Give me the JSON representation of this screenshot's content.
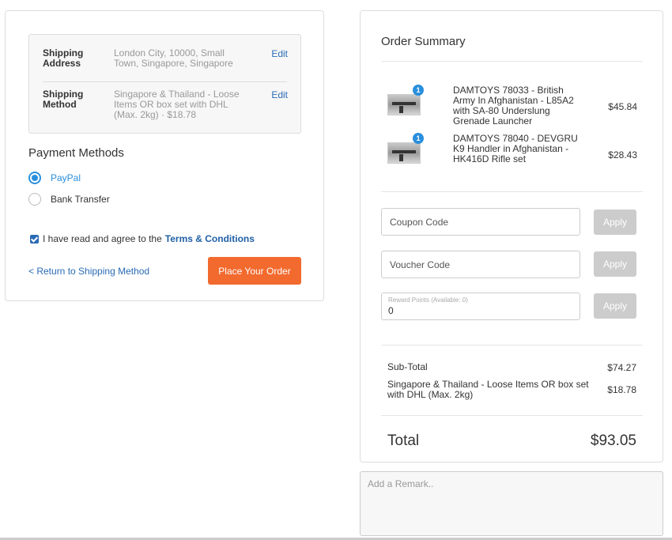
{
  "shipping": {
    "address_label": "Shipping Address",
    "address_value": "London City, 10000, Small Town, Singapore, Singapore",
    "method_label": "Shipping Method",
    "method_value": "Singapore & Thailand - Loose Items OR box set with DHL (Max. 2kg) · $18.78",
    "edit_label": "Edit"
  },
  "payment": {
    "title": "Payment Methods",
    "options": [
      {
        "label": "PayPal",
        "selected": true
      },
      {
        "label": "Bank Transfer",
        "selected": false
      }
    ]
  },
  "agreement": {
    "text": "I have read and agree to the",
    "link": "Terms & Conditions",
    "checked": true
  },
  "actions": {
    "return_label": "< Return to Shipping Method",
    "place_order_label": "Place Your Order"
  },
  "order_summary": {
    "title": "Order Summary",
    "items": [
      {
        "qty": "1",
        "name": "DAMTOYS 78033 - British Army In Afghanistan - L85A2 with SA-80 Underslung Grenade Launcher",
        "price": "$45.84",
        "thumb_icon": "rifle-icon"
      },
      {
        "qty": "1",
        "name": "DAMTOYS 78040 - DEVGRU K9 Handler in Afghanistan - HK416D Rifle set",
        "price": "$28.43",
        "thumb_icon": "rifle-icon"
      }
    ],
    "coupon_placeholder": "Coupon Code",
    "voucher_placeholder": "Voucher Code",
    "reward_label": "Reward Points (Available: 0)",
    "reward_value": "0",
    "apply_label": "Apply",
    "subtotal_label": "Sub-Total",
    "subtotal_value": "$74.27",
    "shipping_label": "Singapore & Thailand - Loose Items OR box set with DHL (Max. 2kg)",
    "shipping_value": "$18.78",
    "total_label": "Total",
    "total_value": "$93.05"
  },
  "remark_placeholder": "Add a Remark..",
  "colors": {
    "accent": "#2a8fdc",
    "order_button": "#f26a2e",
    "link": "#2a6bb5",
    "apply_disabled": "#cccccc"
  }
}
